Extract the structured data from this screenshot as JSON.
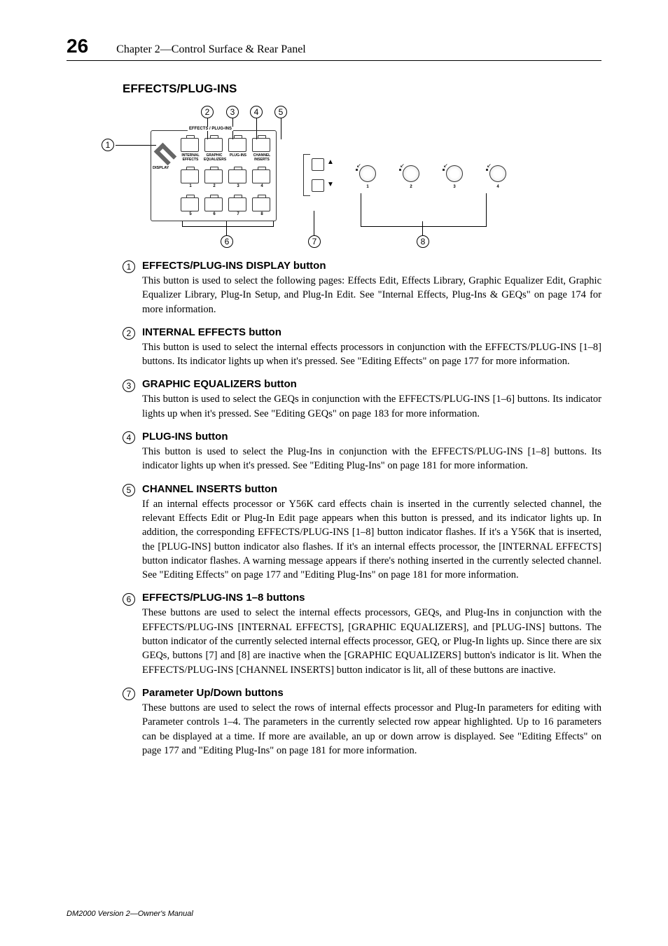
{
  "page": {
    "number": "26",
    "chapter": "Chapter 2—Control Surface & Rear Panel",
    "section_title": "EFFECTS/PLUG-INS",
    "footer": "DM2000 Version 2—Owner's Manual"
  },
  "diagram": {
    "panel_label": "EFFECTS / PLUG-INS",
    "display_label": "DISPLAY",
    "row1_labels": [
      "INTERNAL EFFECTS",
      "GRAPHIC EQUALIZERS",
      "PLUG-INS",
      "CHANNEL INSERTS"
    ],
    "row2_labels": [
      "1",
      "2",
      "3",
      "4"
    ],
    "row3_labels": [
      "5",
      "6",
      "7",
      "8"
    ],
    "knob_labels": [
      "1",
      "2",
      "3",
      "4"
    ],
    "callouts": [
      "1",
      "2",
      "3",
      "4",
      "5",
      "6",
      "7",
      "8"
    ]
  },
  "items": [
    {
      "num": "1",
      "title": "EFFECTS/PLUG-INS DISPLAY button",
      "text": "This button is used to select the following pages: Effects Edit, Effects Library, Graphic Equalizer Edit, Graphic Equalizer Library, Plug-In Setup, and Plug-In Edit. See \"Internal Effects, Plug-Ins & GEQs\" on page 174 for more information."
    },
    {
      "num": "2",
      "title": "INTERNAL EFFECTS button",
      "text": "This button is used to select the internal effects processors in conjunction with the EFFECTS/PLUG-INS [1–8] buttons. Its indicator lights up when it's pressed. See \"Editing Effects\" on page 177 for more information."
    },
    {
      "num": "3",
      "title": "GRAPHIC EQUALIZERS button",
      "text": "This button is used to select the GEQs in conjunction with the EFFECTS/PLUG-INS [1–6] buttons. Its indicator lights up when it's pressed. See \"Editing GEQs\" on page 183 for more information."
    },
    {
      "num": "4",
      "title": "PLUG-INS button",
      "text": "This button is used to select the Plug-Ins in conjunction with the EFFECTS/PLUG-INS [1–8] buttons. Its indicator lights up when it's pressed. See \"Editing Plug-Ins\" on page 181 for more information."
    },
    {
      "num": "5",
      "title": "CHANNEL INSERTS button",
      "text": "If an internal effects processor or Y56K card effects chain is inserted in the currently selected channel, the relevant Effects Edit or Plug-In Edit page appears when this button is pressed, and its indicator lights up. In addition, the corresponding EFFECTS/PLUG-INS [1–8] button indicator flashes. If it's a Y56K that is inserted, the [PLUG-INS] button indicator also flashes. If it's an internal effects processor, the [INTERNAL EFFECTS] button indicator flashes. A warning message appears if there's nothing inserted in the currently selected channel. See \"Editing Effects\" on page 177 and \"Editing Plug-Ins\" on page 181 for more information."
    },
    {
      "num": "6",
      "title": "EFFECTS/PLUG-INS 1–8 buttons",
      "text": "These buttons are used to select the internal effects processors, GEQs, and Plug-Ins in conjunction with the EFFECTS/PLUG-INS [INTERNAL EFFECTS], [GRAPHIC EQUALIZERS], and [PLUG-INS] buttons. The button indicator of the currently selected internal effects processor, GEQ, or Plug-In lights up. Since there are six GEQs, buttons [7] and [8] are inactive when the [GRAPHIC EQUALIZERS] button's indicator is lit. When the EFFECTS/PLUG-INS [CHANNEL INSERTS] button indicator is lit, all of these buttons are inactive."
    },
    {
      "num": "7",
      "title": "Parameter Up/Down buttons",
      "text": "These buttons are used to select the rows of internal effects processor and Plug-In parameters for editing with Parameter controls 1–4. The parameters in the currently selected row appear highlighted. Up to 16 parameters can be displayed at a time. If more are available, an up or down arrow is displayed. See \"Editing Effects\" on page 177 and \"Editing Plug-Ins\" on page 181 for more information."
    }
  ]
}
